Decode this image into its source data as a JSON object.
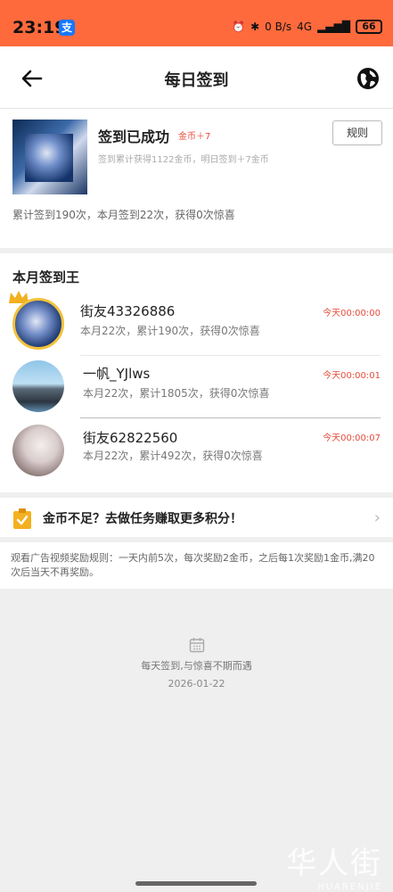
{
  "status_bar": {
    "time": "23:19",
    "network": "4G",
    "data_rate": "0 B/s",
    "battery": "66"
  },
  "header": {
    "title": "每日签到",
    "back_icon": "arrow-left-icon",
    "globe_icon": "globe-icon"
  },
  "signin_card": {
    "headline": "签到已成功",
    "coin_badge": "金币＋7",
    "subline": "签到累计获得1122金币，明日签到＋7金币",
    "rule_button": "规则",
    "summary": "累计签到190次，本月签到22次，获得0次惊喜"
  },
  "monthly_king": {
    "title": "本月签到王",
    "items": [
      {
        "name": "街友43326886",
        "stats": "本月22次，累计190次，获得0次惊喜",
        "time": "今天00:00:00"
      },
      {
        "name": "一帆_YJlws",
        "stats": "本月22次，累计1805次，获得0次惊喜",
        "time": "今天00:00:01"
      },
      {
        "name": "街友62822560",
        "stats": "本月22次，累计492次，获得0次惊喜",
        "time": "今天00:00:07"
      }
    ]
  },
  "task_banner": {
    "text": "金币不足？去做任务赚取更多积分！",
    "icon": "clipboard-check-icon"
  },
  "ad_rules": {
    "text": "观看广告视频奖励规则：一天内前5次，每次奖励2金币，之后每1次奖励1金币,满20次后当天不再奖励。"
  },
  "footer": {
    "slogan": "每天签到,与惊喜不期而遇",
    "date": "2026-01-22",
    "watermark_cn": "华人街",
    "watermark_en": "HUARENJIE"
  },
  "colors": {
    "status_bar": "#ff6a3d",
    "accent_red": "#e74c3c",
    "gold": "#f3b01f"
  }
}
